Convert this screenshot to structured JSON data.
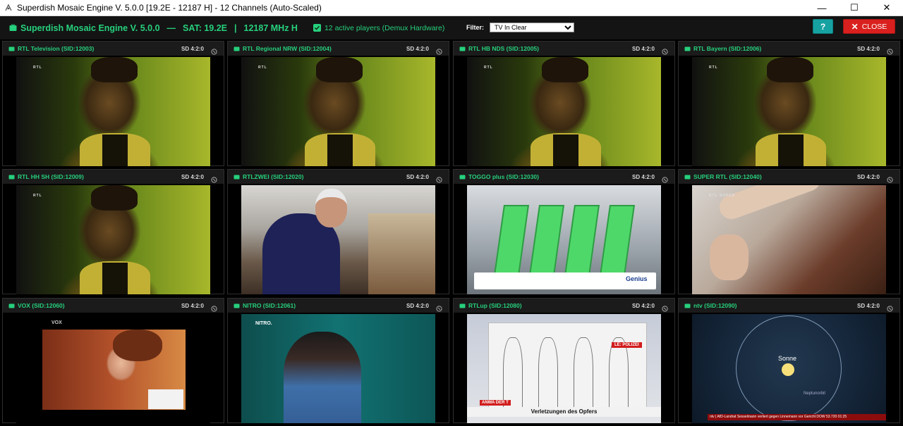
{
  "window": {
    "title": "Superdish Mosaic Engine V. 5.0.0 [19.2E - 12187 H] - 12 Channels (Auto-Scaled)",
    "min_glyph": "—",
    "max_glyph": "☐",
    "close_glyph": "✕"
  },
  "header": {
    "app_name": "Superdish Mosaic Engine V. 5.0.0",
    "dash": "—",
    "sat": "SAT: 19.2E",
    "bar": "|",
    "freq": "12187 MHz H",
    "players": "12 active players (Demux Hardware)",
    "filter_label": "Filter:",
    "filter_value": "TV In Clear",
    "help_label": "?",
    "close_label": "CLOSE"
  },
  "tiles": [
    {
      "name": "RTL Television (SID:12003)",
      "format": "SD 4:2:0",
      "logo": "RTL"
    },
    {
      "name": "RTL Regional NRW (SID:12004)",
      "format": "SD 4:2:0",
      "logo": "RTL"
    },
    {
      "name": "RTL HB NDS (SID:12005)",
      "format": "SD 4:2:0",
      "logo": "RTL"
    },
    {
      "name": "RTL Bayern (SID:12006)",
      "format": "SD 4:2:0",
      "logo": "RTL"
    },
    {
      "name": "RTL HH SH (SID:12009)",
      "format": "SD 4:2:0",
      "logo": "RTL"
    },
    {
      "name": "RTLZWEI (SID:12020)",
      "format": "SD 4:2:0"
    },
    {
      "name": "TOGGO plus (SID:12030)",
      "format": "SD 4:2:0",
      "brand": "Genius"
    },
    {
      "name": "SUPER RTL (SID:12040)",
      "format": "SD 4:2:0",
      "logo": "RTL SUPER"
    },
    {
      "name": "VOX (SID:12060)",
      "format": "SD 4:2:0",
      "logo": "VOX"
    },
    {
      "name": "NITRO (SID:12061)",
      "format": "SD 4:2:0",
      "logo": "NITRO."
    },
    {
      "name": "RTLup (SID:12080)",
      "format": "SD 4:2:0",
      "police": "LE: POLIZEI",
      "caption": "Verletzungen des Opfers",
      "anwa": "ANWA DER T"
    },
    {
      "name": "ntv (SID:12090)",
      "format": "SD 4:2:0",
      "sun": "Sonne",
      "orbit": "Neptunorbit",
      "ticker": "ntv | AfD-Landrat Sesselmann verliert gegen Linnemann vor Gericht   DOW 53.720   01:25"
    }
  ],
  "colors": {
    "accent": "#26d07c",
    "help_bg": "#17a2a2",
    "close_bg": "#d9201e",
    "tile_header": "#1b1b1b"
  }
}
